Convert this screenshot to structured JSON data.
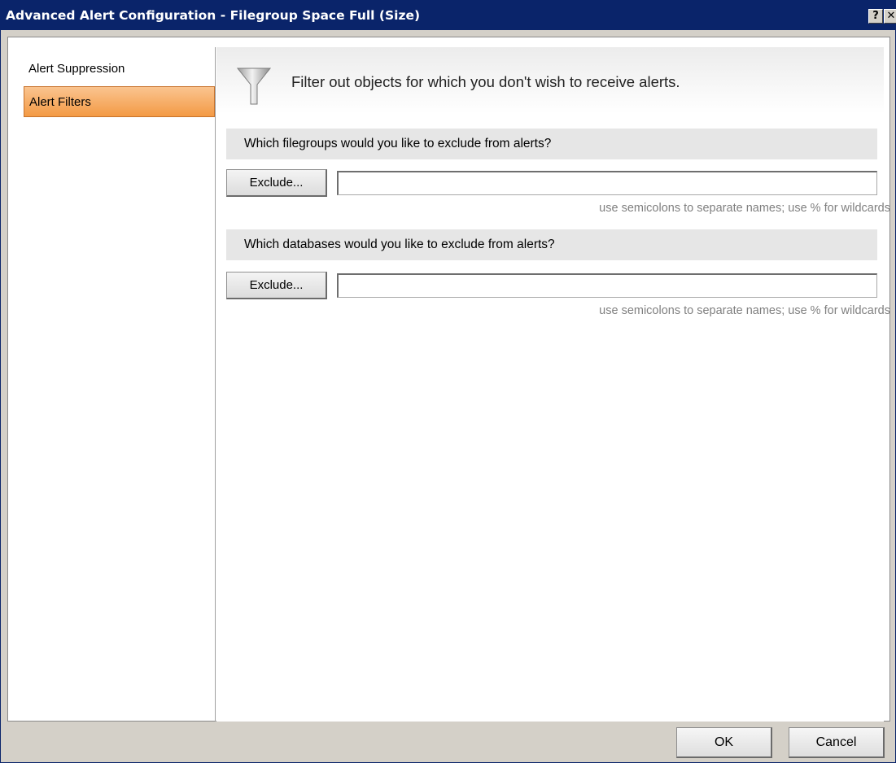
{
  "window": {
    "title": "Advanced Alert Configuration - Filegroup Space Full (Size)",
    "help_label": "?",
    "close_label": "✕"
  },
  "sidebar": {
    "items": [
      {
        "label": "Alert Suppression",
        "selected": false
      },
      {
        "label": "Alert Filters",
        "selected": true
      }
    ],
    "selected_color": "#f39a45"
  },
  "header": {
    "icon": "funnel-icon",
    "text": "Filter out objects for which you don't wish to receive alerts."
  },
  "sections": [
    {
      "question": "Which filegroups would you like to exclude from alerts?",
      "button_label": "Exclude...",
      "value": "",
      "hint": "use semicolons to separate names; use % for wildcards"
    },
    {
      "question": "Which databases would you like to exclude from alerts?",
      "button_label": "Exclude...",
      "value": "",
      "hint": "use semicolons to separate names; use % for wildcards"
    }
  ],
  "footer": {
    "ok_label": "OK",
    "cancel_label": "Cancel"
  }
}
